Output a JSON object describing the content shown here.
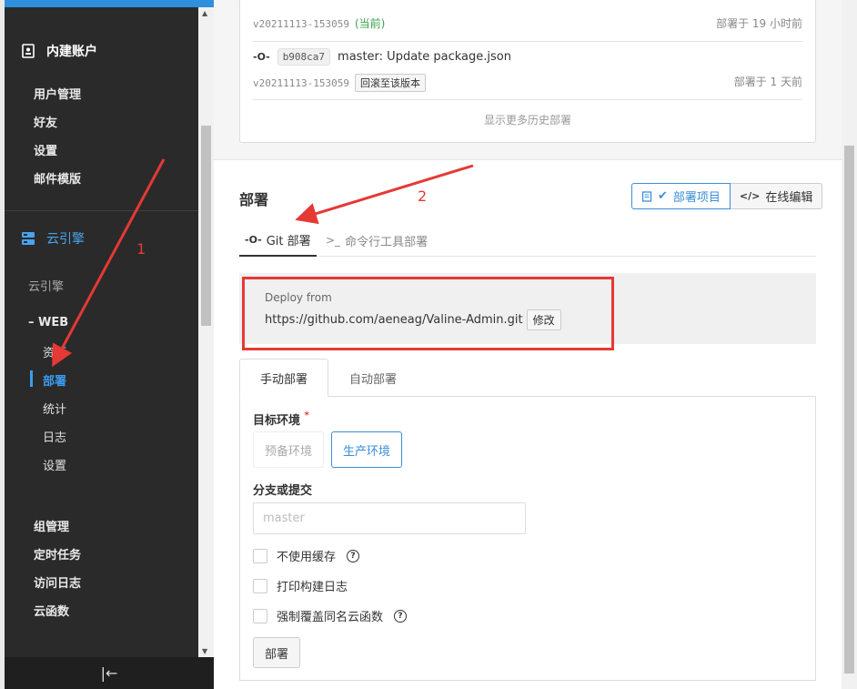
{
  "sidebar": {
    "account_section": "内建账户",
    "account_items": [
      "用户管理",
      "好友",
      "设置",
      "邮件模版"
    ],
    "engine_section": "云引擎",
    "engine_label": "云引擎",
    "web_group": "– WEB",
    "web_items": [
      "资源",
      "部署",
      "统计",
      "日志",
      "设置"
    ],
    "active_item": "部署",
    "more_items": [
      "组管理",
      "定时任务",
      "访问日志",
      "云函数"
    ],
    "collapse_icon": "|←"
  },
  "history": {
    "version1": "v20211113-153059",
    "current_label": "(当前)",
    "time1": "部署于 19 小时前",
    "commit_icon": "-O-",
    "commit_hash": "b908ca7",
    "commit_msg": "master: Update package.json",
    "version2": "v20211113-153059",
    "rollback_label": "回滚至该版本",
    "time2": "部署于 1 天前",
    "show_more": "显示更多历史部署"
  },
  "deploy": {
    "title": "部署",
    "btn_deploy_project": "部署项目",
    "btn_online_edit": "在线编辑",
    "tab_git": "Git 部署",
    "tab_cli": "命令行工具部署",
    "from_label": "Deploy from",
    "from_url": "https://github.com/aeneag/Valine-Admin.git",
    "edit_label": "修改",
    "mode_tabs": [
      "手动部署",
      "自动部署"
    ],
    "env_label": "目标环境",
    "env_required": "*",
    "env_preview": "预备环境",
    "env_prod": "生产环境",
    "branch_label": "分支或提交",
    "branch_placeholder": "master",
    "opt_no_cache": "不使用缓存",
    "opt_print_log": "打印构建日志",
    "opt_overwrite": "强制覆盖同名云函数",
    "submit": "部署"
  },
  "annotations": {
    "n1": "1",
    "n2": "2",
    "color": "#e53935"
  },
  "colors": {
    "accent": "#3b8fd8",
    "sidebar_bg": "#2a2a2a",
    "success": "#3ea34a"
  }
}
